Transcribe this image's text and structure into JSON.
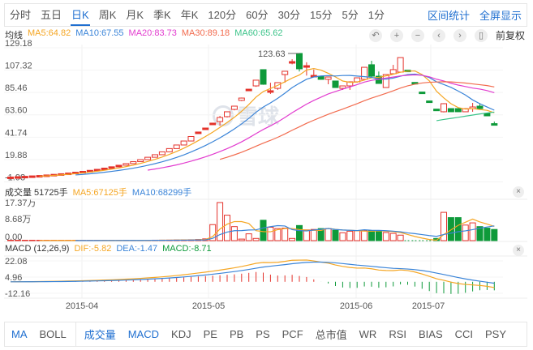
{
  "tabs": [
    "分时",
    "五日",
    "日K",
    "周K",
    "月K",
    "季K",
    "年K",
    "120分",
    "60分",
    "30分",
    "15分",
    "5分",
    "1分"
  ],
  "active_tab": "日K",
  "tab_actions": [
    "区间统计",
    "全屏显示"
  ],
  "legend": {
    "label": "均线",
    "ma5": "MA5:64.82",
    "ma10": "MA10:67.55",
    "ma20": "MA20:83.73",
    "ma30": "MA30:89.18",
    "ma60": "MA60:65.62"
  },
  "tools": [
    "↶",
    "+",
    "−",
    "‹",
    "›",
    "▯"
  ],
  "tool_icons": [
    "undo-icon",
    "zoom-in-icon",
    "zoom-out-icon",
    "chevron-left-icon",
    "chevron-right-icon",
    "candle-width-icon"
  ],
  "adjust": "前复权",
  "colors": {
    "up": "#e4322b",
    "down": "#0e9a3a",
    "ma5": "#f5a623",
    "ma10": "#3a84d8",
    "ma20": "#e23ccf",
    "ma30": "#f26b4e",
    "ma60": "#3cc48a",
    "accent": "#1f6fd0"
  },
  "watermark": "雪球",
  "price_axis": [
    "129.18",
    "107.32",
    "85.46",
    "63.60",
    "41.74",
    "19.88",
    "-1.98"
  ],
  "price_axis_values": [
    129.18,
    107.32,
    85.46,
    63.6,
    41.74,
    19.88,
    -1.98
  ],
  "max_label": "123.63",
  "volume": {
    "label": "成交量 51725手",
    "ma5": "MA5:67125手",
    "ma10": "MA10:68299手",
    "axis": [
      "17.37万",
      "8.68万",
      "0.00"
    ]
  },
  "macd": {
    "label": "MACD (12,26,9)",
    "dif": "DIF:-5.82",
    "dea": "DEA:-1.47",
    "macd": "MACD:-8.71",
    "axis": [
      "22.08",
      "4.96",
      "-12.16"
    ],
    "axis_values": [
      22.08,
      4.96,
      -12.16
    ]
  },
  "close_icon": "×",
  "x_axis": [
    "2015-04",
    "2015-05",
    "2015-06",
    "2015-07"
  ],
  "indicators": [
    "MA",
    "BOLL",
    "成交量",
    "MACD",
    "KDJ",
    "PE",
    "PB",
    "PS",
    "PCF",
    "总市值",
    "WR",
    "RSI",
    "BIAS",
    "CCI",
    "PSY"
  ],
  "indicators_active": [
    "MA",
    "成交量",
    "MACD"
  ],
  "chart_data": {
    "type": "candlestick",
    "ohlc": [
      [
        2.5,
        2.8,
        2.5,
        2.8
      ],
      [
        2.8,
        3.1,
        2.8,
        3.1
      ],
      [
        3.1,
        3.5,
        3.1,
        3.5
      ],
      [
        3.5,
        3.9,
        3.5,
        3.9
      ],
      [
        3.9,
        4.3,
        3.9,
        4.3
      ],
      [
        4.3,
        4.8,
        4.3,
        4.8
      ],
      [
        4.8,
        5.4,
        4.8,
        5.4
      ],
      [
        5.4,
        6.0,
        5.4,
        6.0
      ],
      [
        6.0,
        6.7,
        6.0,
        6.7
      ],
      [
        6.7,
        7.5,
        6.7,
        7.5
      ],
      [
        7.5,
        8.3,
        7.5,
        8.3
      ],
      [
        8.3,
        9.3,
        8.3,
        9.3
      ],
      [
        9.3,
        10.3,
        9.3,
        10.3
      ],
      [
        10.3,
        11.5,
        10.3,
        11.5
      ],
      [
        11.5,
        12.8,
        11.5,
        12.8
      ],
      [
        12.8,
        14.3,
        12.8,
        14.3
      ],
      [
        14.3,
        15.9,
        14.3,
        15.9
      ],
      [
        15.9,
        17.8,
        15.9,
        17.8
      ],
      [
        17.8,
        19.8,
        17.8,
        19.8
      ],
      [
        19.8,
        22.1,
        19.8,
        22.1
      ],
      [
        22.1,
        24.6,
        22.1,
        24.6
      ],
      [
        24.6,
        27.4,
        24.6,
        27.4
      ],
      [
        27.4,
        30.6,
        27.4,
        30.6
      ],
      [
        30.6,
        34.1,
        30.6,
        34.1
      ],
      [
        34.1,
        38.0,
        34.1,
        38.0
      ],
      [
        38.0,
        42.4,
        38.0,
        42.4
      ],
      [
        46.5,
        46.8,
        46.5,
        46.8
      ],
      [
        50.4,
        50.7,
        50.4,
        50.7
      ],
      [
        55.2,
        55.5,
        55.2,
        55.5
      ],
      [
        57,
        62.6,
        53,
        61
      ],
      [
        61.8,
        67,
        61,
        66.6
      ],
      [
        68.9,
        72.5,
        68,
        72.1
      ],
      [
        77.7,
        80.5,
        77,
        80
      ],
      [
        88.4,
        88.7,
        88.4,
        88.7
      ],
      [
        91.9,
        97.5,
        91,
        97.5
      ],
      [
        107.8,
        108,
        93,
        93.5
      ],
      [
        86.9,
        95,
        84,
        87.2
      ],
      [
        89.5,
        95.5,
        88,
        95.1
      ],
      [
        103,
        106.5,
        95,
        106.2
      ],
      [
        115.4,
        118,
        113,
        115.7
      ],
      [
        123.63,
        123.63,
        106,
        108.6
      ],
      [
        111.4,
        115,
        102,
        111.7
      ],
      [
        101.9,
        108,
        101,
        102.2
      ],
      [
        101.4,
        101.4,
        98,
        98.3
      ],
      [
        98.3,
        100.6,
        93.5,
        100.6
      ],
      [
        96.7,
        97,
        90,
        90.3
      ],
      [
        89.5,
        92,
        88,
        91.9
      ],
      [
        91.9,
        96,
        88,
        95.9
      ],
      [
        95.9,
        100,
        95,
        99.8
      ],
      [
        98.3,
        110.1,
        98,
        110.1
      ],
      [
        112.6,
        116.5,
        100,
        101.4
      ],
      [
        101.4,
        106,
        94,
        94.3
      ],
      [
        90.3,
        103,
        90,
        103
      ],
      [
        103.8,
        112.5,
        103,
        107.8
      ],
      [
        105.4,
        119.6,
        105,
        119.6
      ],
      [
        107.3,
        107.3,
        107,
        107
      ],
      [
        95.3,
        95.3,
        95,
        95
      ],
      [
        85.9,
        85.9,
        85.6,
        85.6
      ],
      [
        77.2,
        77.2,
        76.9,
        76.9
      ],
      [
        69.2,
        69.2,
        68.9,
        68.9
      ],
      [
        66.6,
        75,
        66,
        74.5
      ],
      [
        69.7,
        70,
        66.5,
        66.6
      ],
      [
        69.7,
        70,
        66.5,
        66.6
      ],
      [
        66.6,
        69.7,
        66.5,
        69.7
      ],
      [
        69.7,
        75.3,
        66.6,
        71.3
      ],
      [
        72.1,
        75,
        69,
        69.7
      ],
      [
        65,
        65,
        62.6,
        62.6
      ],
      [
        55,
        57,
        54.7,
        54.7
      ]
    ],
    "volume_wan": [
      0.02,
      0.02,
      0.03,
      0.03,
      0.04,
      0.04,
      0.05,
      0.05,
      0.06,
      0.06,
      0.07,
      0.08,
      0.09,
      0.1,
      0.1,
      0.12,
      0.13,
      0.15,
      0.16,
      0.18,
      0.2,
      0.22,
      0.25,
      0.3,
      0.35,
      0.4,
      0.5,
      0.8,
      7.3,
      17.37,
      11.6,
      6.4,
      0.7,
      3.1,
      1.0,
      9.3,
      6.1,
      5.5,
      5.7,
      1.0,
      6.9,
      4.9,
      5.1,
      5.5,
      5.5,
      4.7,
      3.6,
      4.3,
      4.5,
      4.5,
      4.5,
      4.5,
      3.7,
      3.3,
      2.5,
      0,
      0,
      0,
      0,
      1.0,
      12.9,
      10.5,
      10.5,
      7.1,
      8.1,
      6.4,
      5.7,
      5.1
    ],
    "ylim": [
      -1.98,
      129.18
    ],
    "volume_ylim": [
      0,
      17.37
    ],
    "macd_ylim": [
      -12.16,
      22.08
    ]
  }
}
